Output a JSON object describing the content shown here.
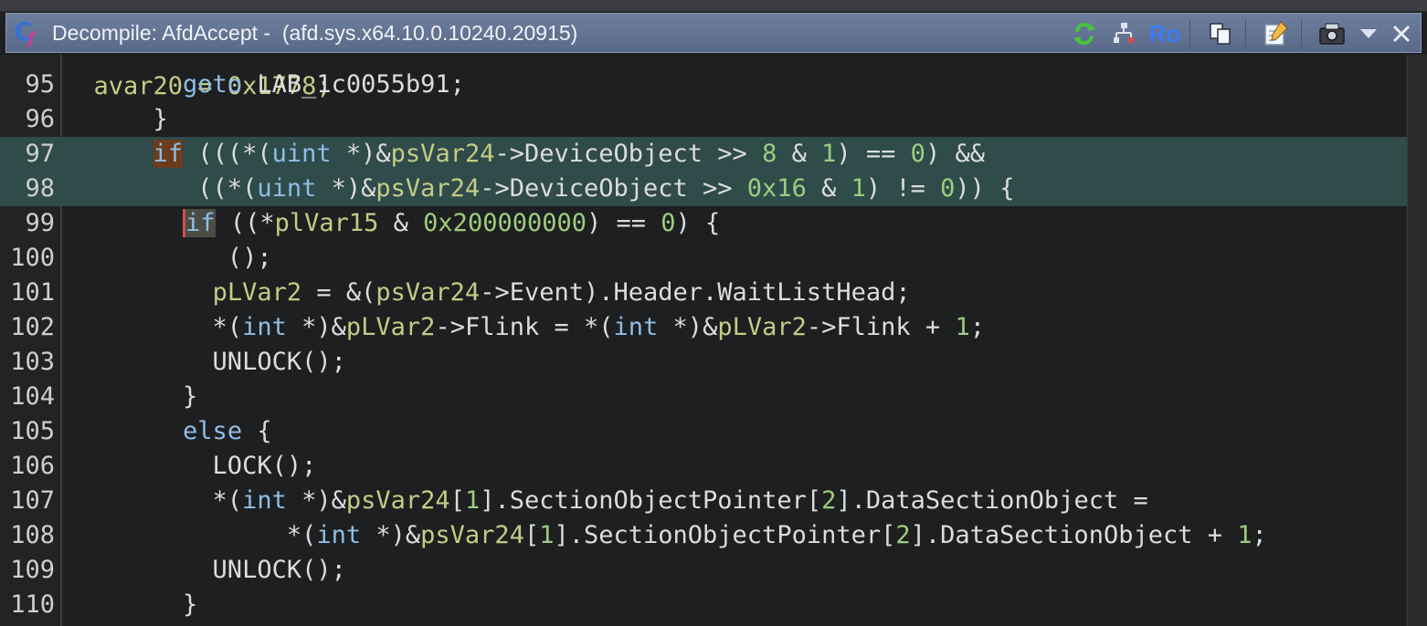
{
  "window": {
    "title": "Decompile: AfdAccept -  (afd.sys.x64.10.0.10240.20915)",
    "toolbar": {
      "ro_label": "Ro"
    },
    "colors": {
      "titlebar": "#5f7090",
      "highlight_line": "#2f4b4a",
      "keyword": "#8fbde6",
      "variable": "#c3cc84",
      "number": "#9dcc7e"
    }
  },
  "code": {
    "partial_line": "  avar20 = 0x1778;",
    "lines": [
      {
        "n": "95",
        "hl": false,
        "segs": [
          {
            "t": "        "
          },
          {
            "t": "goto",
            "c": "kw"
          },
          {
            "t": " LAB_1c0055b91;"
          }
        ]
      },
      {
        "n": "96",
        "hl": false,
        "segs": [
          {
            "t": "      }"
          }
        ]
      },
      {
        "n": "97",
        "hl": true,
        "segs": [
          {
            "t": "      "
          },
          {
            "t": "if",
            "c": "kw kwhl"
          },
          {
            "t": " (((*("
          },
          {
            "t": "uint",
            "c": "ty"
          },
          {
            "t": " *)&"
          },
          {
            "t": "psVar24",
            "c": "var"
          },
          {
            "t": "->DeviceObject >> "
          },
          {
            "t": "8",
            "c": "num"
          },
          {
            "t": " & "
          },
          {
            "t": "1",
            "c": "num"
          },
          {
            "t": ") == "
          },
          {
            "t": "0",
            "c": "num"
          },
          {
            "t": ") &&"
          }
        ]
      },
      {
        "n": "98",
        "hl": true,
        "segs": [
          {
            "t": "         ((*("
          },
          {
            "t": "uint",
            "c": "ty"
          },
          {
            "t": " *)&"
          },
          {
            "t": "psVar24",
            "c": "var"
          },
          {
            "t": "->DeviceObject >> "
          },
          {
            "t": "0x16",
            "c": "num"
          },
          {
            "t": " & "
          },
          {
            "t": "1",
            "c": "num"
          },
          {
            "t": ") != "
          },
          {
            "t": "0",
            "c": "num"
          },
          {
            "t": ")) {"
          }
        ]
      },
      {
        "n": "99",
        "hl": false,
        "segs": [
          {
            "t": "        "
          },
          {
            "t": "if",
            "c": "kw kwhl2"
          },
          {
            "t": " ((*"
          },
          {
            "t": "plVar15",
            "c": "var"
          },
          {
            "t": " & "
          },
          {
            "t": "0x200000000",
            "c": "num"
          },
          {
            "t": ") == "
          },
          {
            "t": "0",
            "c": "num"
          },
          {
            "t": ") {"
          }
        ]
      },
      {
        "n": "100",
        "hl": false,
        "segs": [
          {
            "t": "           ();"
          }
        ]
      },
      {
        "n": "101",
        "hl": false,
        "segs": [
          {
            "t": "          "
          },
          {
            "t": "pLVar2",
            "c": "var"
          },
          {
            "t": " = &("
          },
          {
            "t": "psVar24",
            "c": "var"
          },
          {
            "t": "->Event).Header.WaitListHead;"
          }
        ]
      },
      {
        "n": "102",
        "hl": false,
        "segs": [
          {
            "t": "          *("
          },
          {
            "t": "int",
            "c": "ty"
          },
          {
            "t": " *)&"
          },
          {
            "t": "pLVar2",
            "c": "var"
          },
          {
            "t": "->Flink = *("
          },
          {
            "t": "int",
            "c": "ty"
          },
          {
            "t": " *)&"
          },
          {
            "t": "pLVar2",
            "c": "var"
          },
          {
            "t": "->Flink + "
          },
          {
            "t": "1",
            "c": "num"
          },
          {
            "t": ";"
          }
        ]
      },
      {
        "n": "103",
        "hl": false,
        "segs": [
          {
            "t": "          UNLOCK();"
          }
        ]
      },
      {
        "n": "104",
        "hl": false,
        "segs": [
          {
            "t": "        }"
          }
        ]
      },
      {
        "n": "105",
        "hl": false,
        "segs": [
          {
            "t": "        "
          },
          {
            "t": "else",
            "c": "kw"
          },
          {
            "t": " {"
          }
        ]
      },
      {
        "n": "106",
        "hl": false,
        "segs": [
          {
            "t": "          LOCK();"
          }
        ]
      },
      {
        "n": "107",
        "hl": false,
        "segs": [
          {
            "t": "          *("
          },
          {
            "t": "int",
            "c": "ty"
          },
          {
            "t": " *)&"
          },
          {
            "t": "psVar24",
            "c": "var"
          },
          {
            "t": "["
          },
          {
            "t": "1",
            "c": "num"
          },
          {
            "t": "].SectionObjectPointer["
          },
          {
            "t": "2",
            "c": "num"
          },
          {
            "t": "].DataSectionObject ="
          }
        ]
      },
      {
        "n": "108",
        "hl": false,
        "segs": [
          {
            "t": "               *("
          },
          {
            "t": "int",
            "c": "ty"
          },
          {
            "t": " *)&"
          },
          {
            "t": "psVar24",
            "c": "var"
          },
          {
            "t": "["
          },
          {
            "t": "1",
            "c": "num"
          },
          {
            "t": "].SectionObjectPointer["
          },
          {
            "t": "2",
            "c": "num"
          },
          {
            "t": "].DataSectionObject + "
          },
          {
            "t": "1",
            "c": "num"
          },
          {
            "t": ";"
          }
        ]
      },
      {
        "n": "109",
        "hl": false,
        "segs": [
          {
            "t": "          UNLOCK();"
          }
        ]
      },
      {
        "n": "110",
        "hl": false,
        "segs": [
          {
            "t": "        }"
          }
        ]
      }
    ]
  }
}
